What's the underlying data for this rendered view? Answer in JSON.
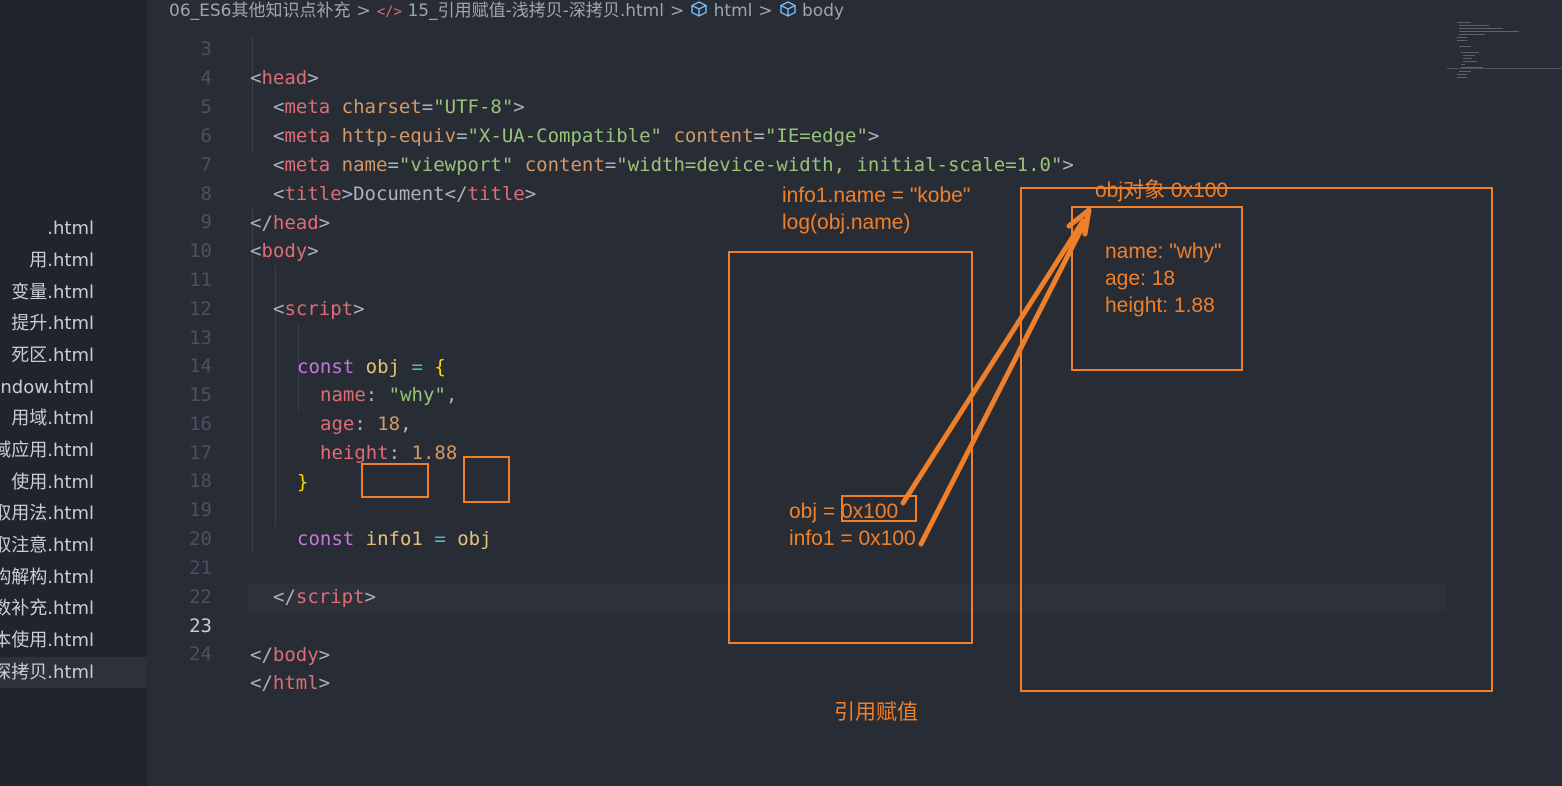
{
  "sidebar": {
    "items": [
      {
        "label": ".html"
      },
      {
        "label": "用.html"
      },
      {
        "label": "变量.html"
      },
      {
        "label": "提升.html"
      },
      {
        "label": "死区.html"
      },
      {
        "label": "ndow.html"
      },
      {
        "label": "用域.html"
      },
      {
        "label": "域应用.html"
      },
      {
        "label": "使用.html"
      },
      {
        "label": "取用法.html"
      },
      {
        "label": "取注意.html"
      },
      {
        "label": "构解构.html"
      },
      {
        "label": "数补充.html"
      },
      {
        "label": "本使用.html"
      },
      {
        "label": "深拷贝.html"
      }
    ]
  },
  "breadcrumb": {
    "folder": "06_ES6其他知识点补充",
    "file": "15_引用赋值-浅拷贝-深拷贝.html",
    "node1": "html",
    "node2": "body"
  },
  "lines": {
    "n3": "3",
    "n4": "4",
    "n5": "5",
    "n6": "6",
    "n7": "7",
    "n8": "8",
    "n9": "9",
    "n10": "10",
    "n11": "11",
    "n12": "12",
    "n13": "13",
    "n14": "14",
    "n15": "15",
    "n16": "16",
    "n17": "17",
    "n18": "18",
    "n19": "19",
    "n20": "20",
    "n21": "21",
    "n22": "22",
    "n23": "23",
    "n24": "24"
  },
  "code": {
    "head_tag": "head",
    "meta": "meta",
    "charset_attr": "charset",
    "charset_val": "\"UTF-8\"",
    "http_equiv_attr": "http-equiv",
    "http_equiv_val": "\"X-UA-Compatible\"",
    "content_attr": "content",
    "content_val1": "\"IE=edge\"",
    "name_attr": "name",
    "viewport_val": "\"viewport\"",
    "content_val2": "\"width=device-width, initial-scale=1.0\"",
    "title_tag": "title",
    "title_text": "Document",
    "body_tag": "body",
    "html_tag": "html",
    "script_tag": "script",
    "const_kw": "const",
    "obj_var": "obj",
    "info1_var": "info1",
    "name_key": "name",
    "name_val": "\"why\"",
    "age_key": "age",
    "age_val": "18",
    "height_key": "height",
    "height_val": "1.88"
  },
  "annotations": {
    "assign_line1": "info1.name = \"kobe\"",
    "assign_line2": "log(obj.name)",
    "heap_title": "obj对象 0x100",
    "heap_name": "name: \"why\"",
    "heap_age": "age: 18",
    "heap_height": "height: 1.88",
    "stack_obj_label": "obj = ",
    "stack_obj_addr": "0x100",
    "stack_info1": "info1 = 0x100",
    "caption": "引用赋值"
  },
  "colors": {
    "editor_bg": "#282c34",
    "sidebar_bg": "#21252b",
    "annotation": "#f07f2a"
  }
}
